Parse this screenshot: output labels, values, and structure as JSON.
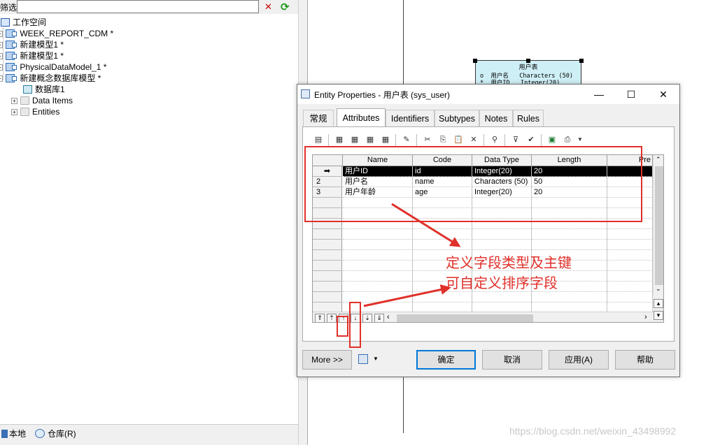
{
  "filter": {
    "label": "筛选",
    "value": ""
  },
  "tree": {
    "workspace": "工作空间",
    "items": [
      "WEEK_REPORT_CDM *",
      "新建模型1 *",
      "新建模型1 *",
      "PhysicalDataModel_1 *",
      "新建概念数据库模型 *"
    ],
    "children": [
      "数据库1",
      "Data Items",
      "Entities"
    ]
  },
  "bottom_tabs": [
    "本地",
    "仓库(R)"
  ],
  "entity": {
    "title": "用户表",
    "rows": [
      {
        "flag": "o",
        "name": "用户名",
        "type": "Characters (50)"
      },
      {
        "flag": "*",
        "name": "用户ID",
        "type": "Integer(20)"
      }
    ]
  },
  "dialog": {
    "title": "Entity Properties - 用户表 (sys_user)",
    "tabs": [
      "常规",
      "Attributes",
      "Identifiers",
      "Subtypes",
      "Notes",
      "Rules"
    ],
    "active_tab": "Attributes",
    "columns": [
      "Name",
      "Code",
      "Data Type",
      "Length",
      "Pre"
    ],
    "rows": [
      {
        "marker": "➡",
        "name": "用户ID",
        "code": "id",
        "type": "Integer(20)",
        "length": "20"
      },
      {
        "marker": "2",
        "name": "用户名",
        "code": "name",
        "type": "Characters (50)",
        "length": "50"
      },
      {
        "marker": "3",
        "name": "用户年龄",
        "code": "age",
        "type": "Integer(20)",
        "length": "20"
      }
    ],
    "buttons": {
      "more": "More >>",
      "ok": "确定",
      "cancel": "取消",
      "apply": "应用(A)",
      "help": "帮助"
    }
  },
  "annotations": [
    "定义字段类型及主键",
    "可自定义排序字段"
  ],
  "watermark": "https://blog.csdn.net/weixin_43498992",
  "colors": {
    "annotation": "#e0302a",
    "selected_row": "#000000",
    "entity_fill": "#cfeff6"
  }
}
